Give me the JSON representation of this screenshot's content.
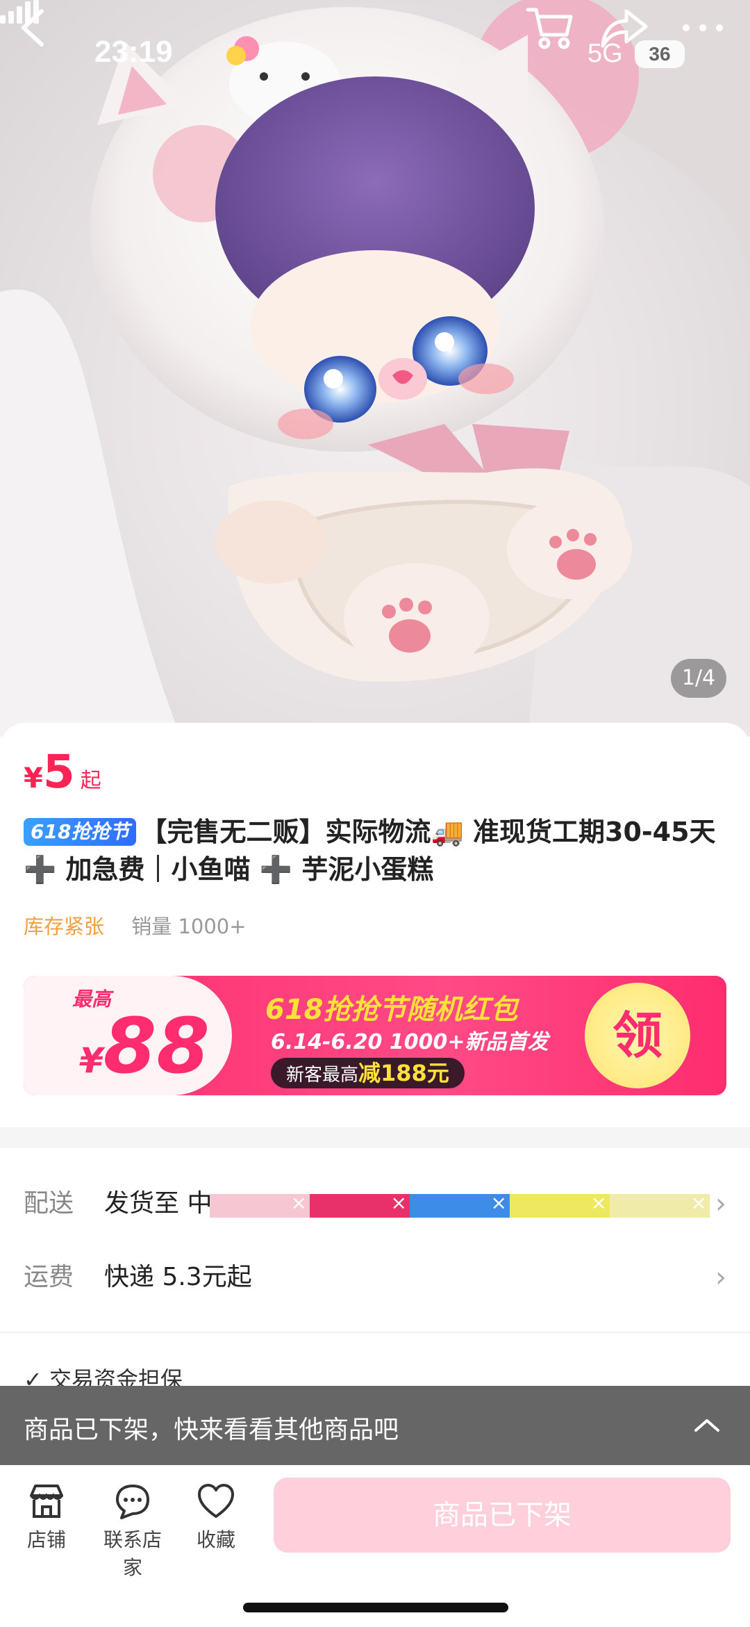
{
  "status_bar": {
    "time": "23:19",
    "network": "5G",
    "battery": "36"
  },
  "gallery": {
    "counter": "1/4"
  },
  "product": {
    "price_currency": "¥",
    "price": "5",
    "price_suffix": "起",
    "sale_tag": "618抢抢节",
    "title": "【完售无二贩】实际物流🚚 准现货工期30-45天 ➕ 加急费｜小鱼喵 ➕ 芋泥小蛋糕",
    "stock_tag": "库存紧张",
    "sales": "销量 1000+"
  },
  "banner": {
    "coupon_top": "最高",
    "coupon_currency": "¥",
    "coupon_amount": "88",
    "title": "618抢抢节随机红包",
    "subtitle": "6.14-6.20 1000+新品首发",
    "pill_prefix": "新客最高",
    "pill_highlight": "减188元",
    "claim": "领"
  },
  "delivery": {
    "label": "配送",
    "value": "发货至 中"
  },
  "shipping": {
    "label": "运费",
    "value": "快递 5.3元起"
  },
  "guarantee": "交易资金担保",
  "toast": {
    "text": "商品已下架，快来看看其他商品吧"
  },
  "bottom_bar": {
    "shop": "店铺",
    "contact": "联系店家",
    "favorite": "收藏",
    "cta": "商品已下架"
  },
  "colors": {
    "accent": "#ff2255",
    "strip": [
      "#f6c6d2",
      "#e8306a",
      "#3d8de8",
      "#ece860",
      "#f0eba8"
    ]
  }
}
